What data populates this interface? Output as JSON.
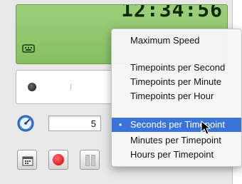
{
  "display": {
    "clock_text": "12:34:56"
  },
  "controls": {
    "speed_value": "5"
  },
  "menu": {
    "items": [
      {
        "label": "Maximum Speed"
      },
      {
        "label": "Timepoints per Second"
      },
      {
        "label": "Timepoints per Minute"
      },
      {
        "label": "Timepoints per Hour"
      },
      {
        "label": "Seconds per Timepoint",
        "checked": true
      },
      {
        "label": "Minutes per Timepoint"
      },
      {
        "label": "Hours per Timepoint"
      }
    ],
    "check_glyph": "•"
  },
  "colors": {
    "lcd_green": "#9ccf7a",
    "menu_highlight": "#3b74d8",
    "record_red": "#d40000",
    "speed_icon_blue": "#3a7bd5"
  },
  "icons": [
    "keyboard-icon",
    "speed-gauge-icon",
    "calendar-icon",
    "record-icon",
    "pause-icon",
    "pointer-cursor-icon"
  ]
}
